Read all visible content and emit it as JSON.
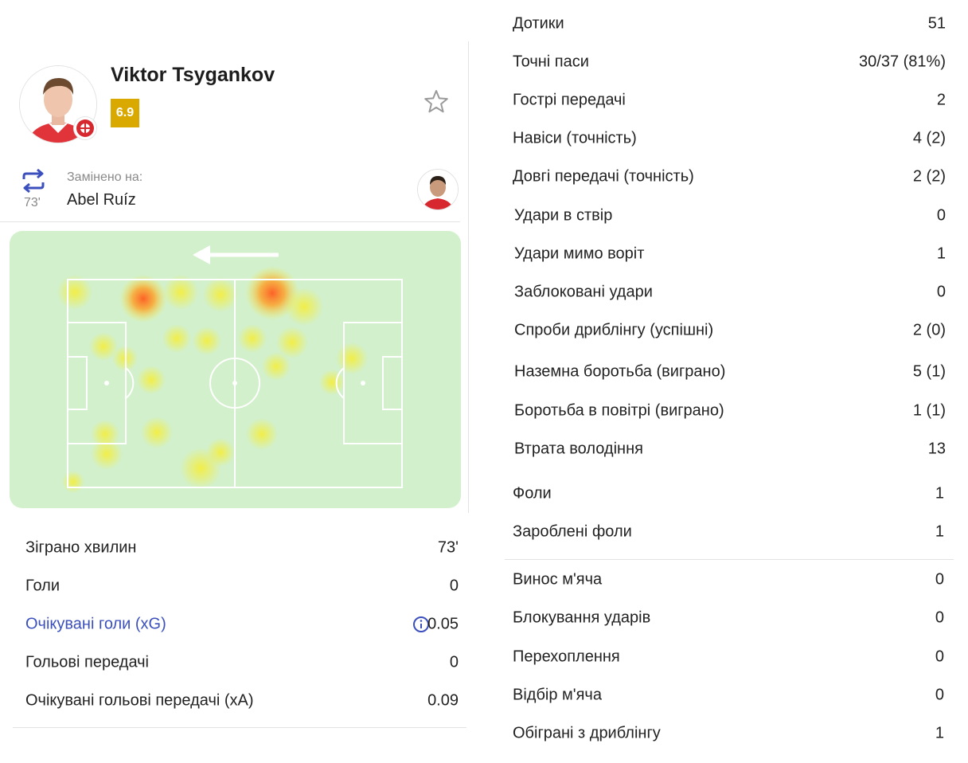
{
  "player": {
    "name": "Viktor Tsygankov",
    "rating": "6.9"
  },
  "substitution": {
    "minute": "73'",
    "label": "Замінено на:",
    "name": "Abel Ruíz"
  },
  "colors": {
    "rating_badge": "#d9a900",
    "link": "#3b4fbd",
    "pitch": "#d2f0cb",
    "sub_icon": "#3b4fbd"
  },
  "icons": {
    "favorite": "star-outline-icon",
    "substitution": "swap-arrows-icon",
    "info": "info-circle-icon",
    "direction": "arrow-left-icon"
  },
  "left_stats": [
    {
      "label": "Зіграно хвилин",
      "value": "73'"
    },
    {
      "label": "Голи",
      "value": "0"
    },
    {
      "label": "Очікувані голи (xG)",
      "value": "0.05"
    },
    {
      "label": "Гольові передачі",
      "value": "0"
    },
    {
      "label": "Очікувані гольові передачі (xA)",
      "value": "0.09"
    }
  ],
  "right_stats": [
    {
      "label": "Дотики",
      "value": "51"
    },
    {
      "label": "Точні паси",
      "value": "30/37 (81%)"
    },
    {
      "label": "Гострі передачі",
      "value": "2"
    },
    {
      "label": "Навіси (точність)",
      "value": "4 (2)"
    },
    {
      "label": "Довгі передачі (точність)",
      "value": "2 (2)"
    },
    {
      "label": "Удари в ствір",
      "value": "0"
    },
    {
      "label": "Удари мимо воріт",
      "value": "1"
    },
    {
      "label": "Заблоковані удари",
      "value": "0"
    },
    {
      "label": "Спроби дриблінгу (успішні)",
      "value": "2 (0)"
    },
    {
      "label": "Наземна боротьба (виграно)",
      "value": "5 (1)"
    },
    {
      "label": "Боротьба в повітрі (виграно)",
      "value": "1 (1)"
    },
    {
      "label": "Втрата володіння",
      "value": "13"
    },
    {
      "label": "Фоли",
      "value": "1"
    },
    {
      "label": "Зароблені фоли",
      "value": "1"
    },
    {
      "label": "Винос м'яча",
      "value": "0"
    },
    {
      "label": "Блокування ударів",
      "value": "0"
    },
    {
      "label": "Перехоплення",
      "value": "0"
    },
    {
      "label": "Відбір м'яча",
      "value": "0"
    },
    {
      "label": "Обіграні з дриблінгу",
      "value": "1"
    }
  ]
}
